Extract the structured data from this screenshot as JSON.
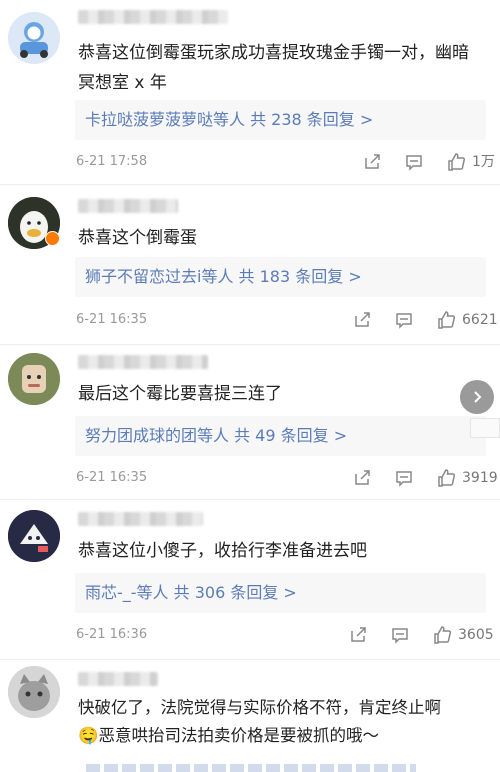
{
  "comments": [
    {
      "text": "恭喜这位倒霉蛋玩家成功喜提玫瑰金手镯一对，幽暗冥想室 x 年",
      "reply_summary": "卡拉哒菠萝菠萝哒等人 共 238 条回复 >",
      "time": "6-21 17:58",
      "likes": "1万",
      "icons": [
        "share-icon",
        "comment-icon",
        "like-icon"
      ]
    },
    {
      "text": "恭喜这个倒霉蛋",
      "reply_summary": "狮子不留恋过去i等人 共 183 条回复 >",
      "time": "6-21 16:35",
      "likes": "6621",
      "icons": [
        "share-icon",
        "comment-icon",
        "like-icon"
      ]
    },
    {
      "text": "最后这个霉比要喜提三连了",
      "reply_summary": "努力团成球的团等人 共 49 条回复 >",
      "time": "6-21 16:35",
      "likes": "3919",
      "icons": [
        "share-icon",
        "comment-icon",
        "like-icon"
      ]
    },
    {
      "text": "恭喜这位小傻子，收拾行李准备进去吧",
      "reply_summary": "雨芯-_-等人 共 306 条回复 >",
      "time": "6-21 16:36",
      "likes": "3605",
      "icons": [
        "share-icon",
        "comment-icon",
        "like-icon"
      ]
    },
    {
      "text_line1": "快破亿了，法院觉得与实际价格不符，肯定终止啊",
      "text_line2": "恶意哄抬司法拍卖价格是要被抓的哦～",
      "emoji": "🤤"
    }
  ],
  "colors": {
    "link": "#5b7cb8",
    "meta": "#999999",
    "reply_bg": "#f7f7f7"
  }
}
